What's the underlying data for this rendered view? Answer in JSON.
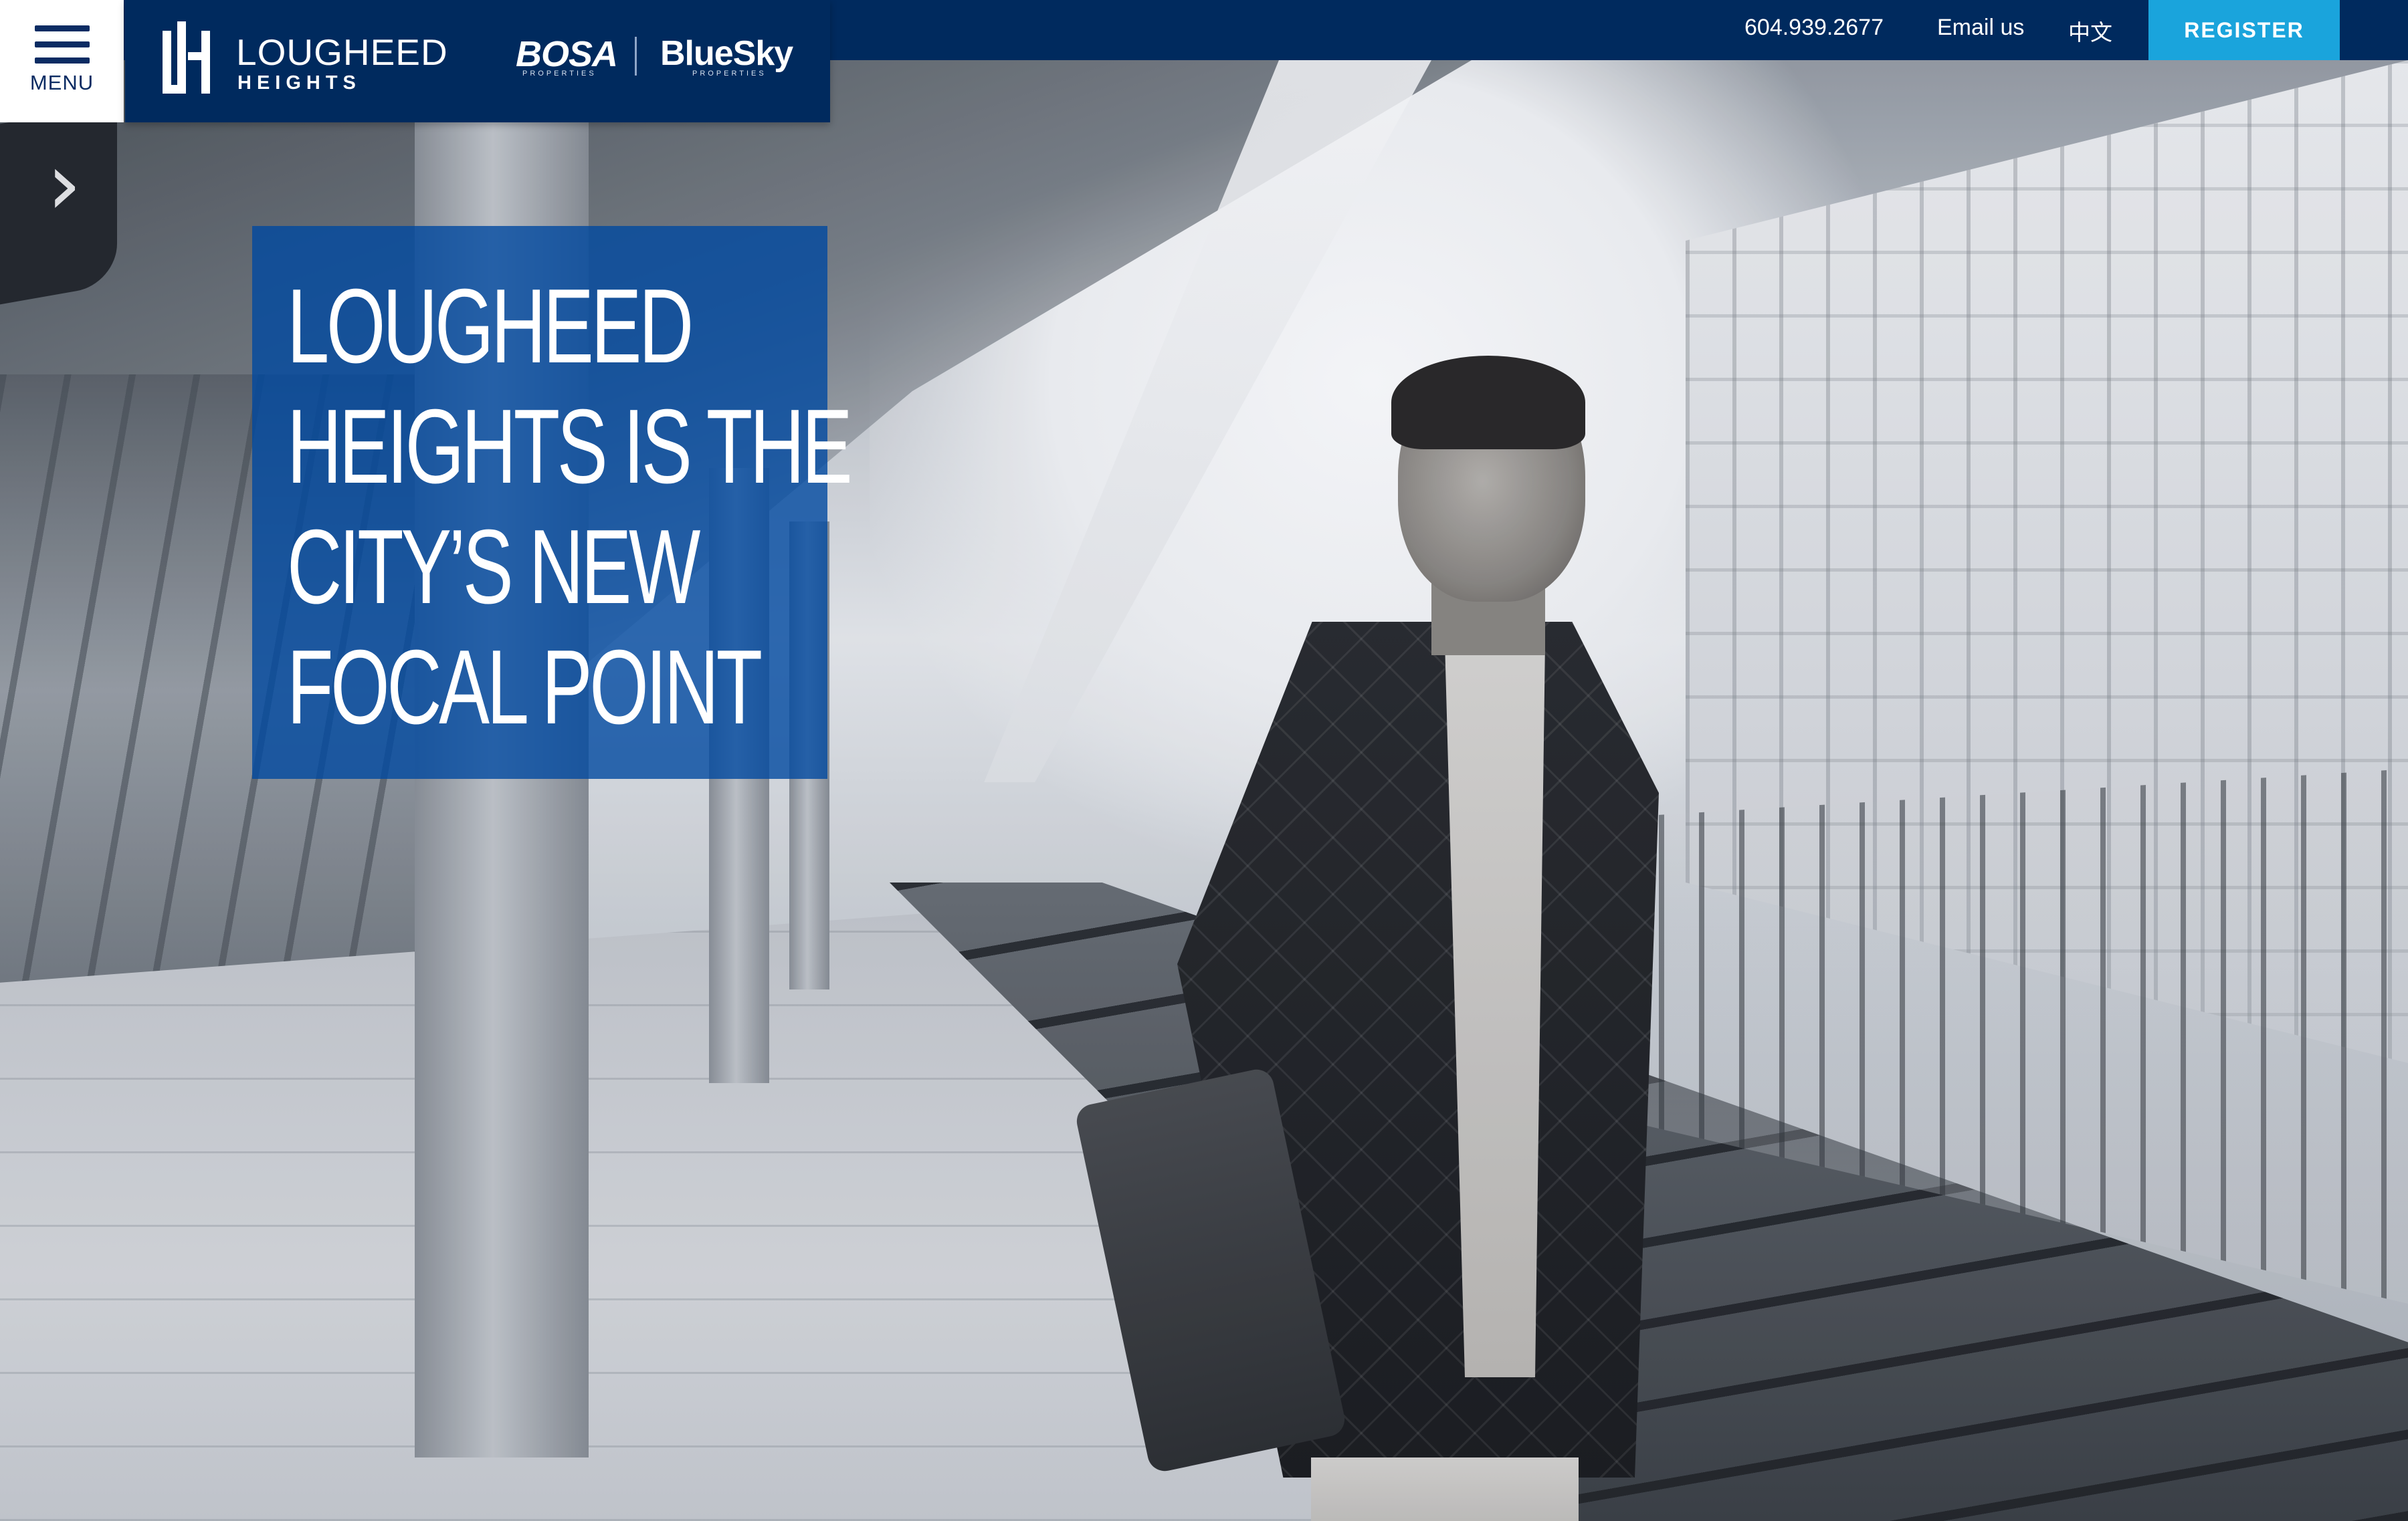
{
  "header": {
    "menu_label": "MENU",
    "brand": {
      "name": "LOUGHEED",
      "sub": "HEIGHTS"
    },
    "partners": [
      {
        "name": "BOSA",
        "sub": "PROPERTIES"
      },
      {
        "name": "BlueSky",
        "sub": "PROPERTIES"
      }
    ],
    "phone": "604.939.2677",
    "email_label": "Email us",
    "language_label": "中文",
    "register_label": "REGISTER"
  },
  "hero": {
    "headline_lines": [
      "LOUGHEED",
      "HEIGHTS IS THE",
      "CITY’S NEW",
      "FOCAL POINT"
    ]
  },
  "colors": {
    "navy": "#002a5e",
    "accent": "#1aa4dc",
    "headline_box": "#0048a0"
  },
  "icons": {
    "menu": "hamburger-icon",
    "logo": "lh-monogram-icon",
    "sign": "arrow-right-icon"
  }
}
